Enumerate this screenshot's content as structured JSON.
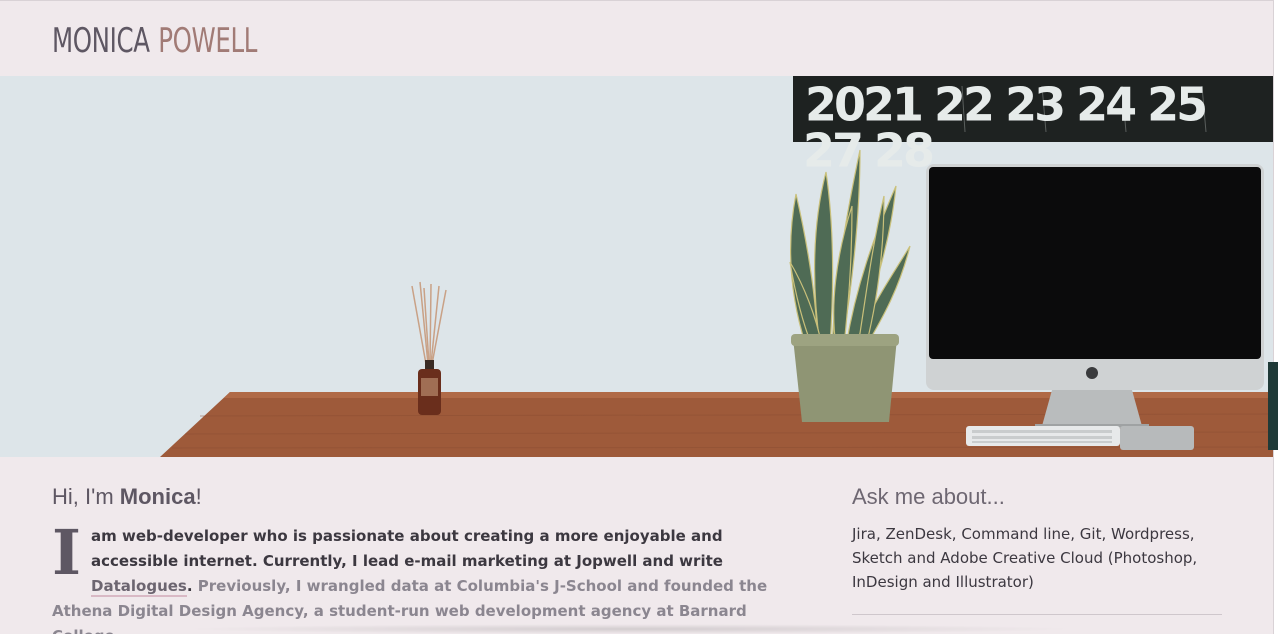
{
  "header": {
    "logo_first": "MONICA",
    "logo_last": "POWELL"
  },
  "hero": {
    "image": "desk-with-plant-and-imac-photo",
    "calendar_row_1": "2021 22 23 24 25",
    "calendar_row_2": "27 28"
  },
  "intro": {
    "greeting_prefix": "Hi, I'm ",
    "greeting_name": "Monica",
    "greeting_suffix": "!",
    "dropcap": "I",
    "bio_strong": " am web-developer who is passionate about creating a more enjoyable and accessible internet. Currently, I lead e-mail marketing at Jopwell and write ",
    "bio_link": "Datalogues",
    "bio_period": ".",
    "bio_muted": " Previously, I wrangled data at Columbia's J-School and founded the Athena Digital Design Agency, a student-run web development agency at Barnard College."
  },
  "aside": {
    "title": "Ask me about...",
    "body": "Jira, ZenDesk, Command line, Git, Wordpress, Sketch and Adobe Creative Cloud (Photoshop, InDesign and Illustrator)"
  },
  "colors": {
    "background": "#f0e9ec",
    "logo_first": "#5e5763",
    "logo_last": "#a17b76",
    "link_underline": "#d9b9c5"
  }
}
